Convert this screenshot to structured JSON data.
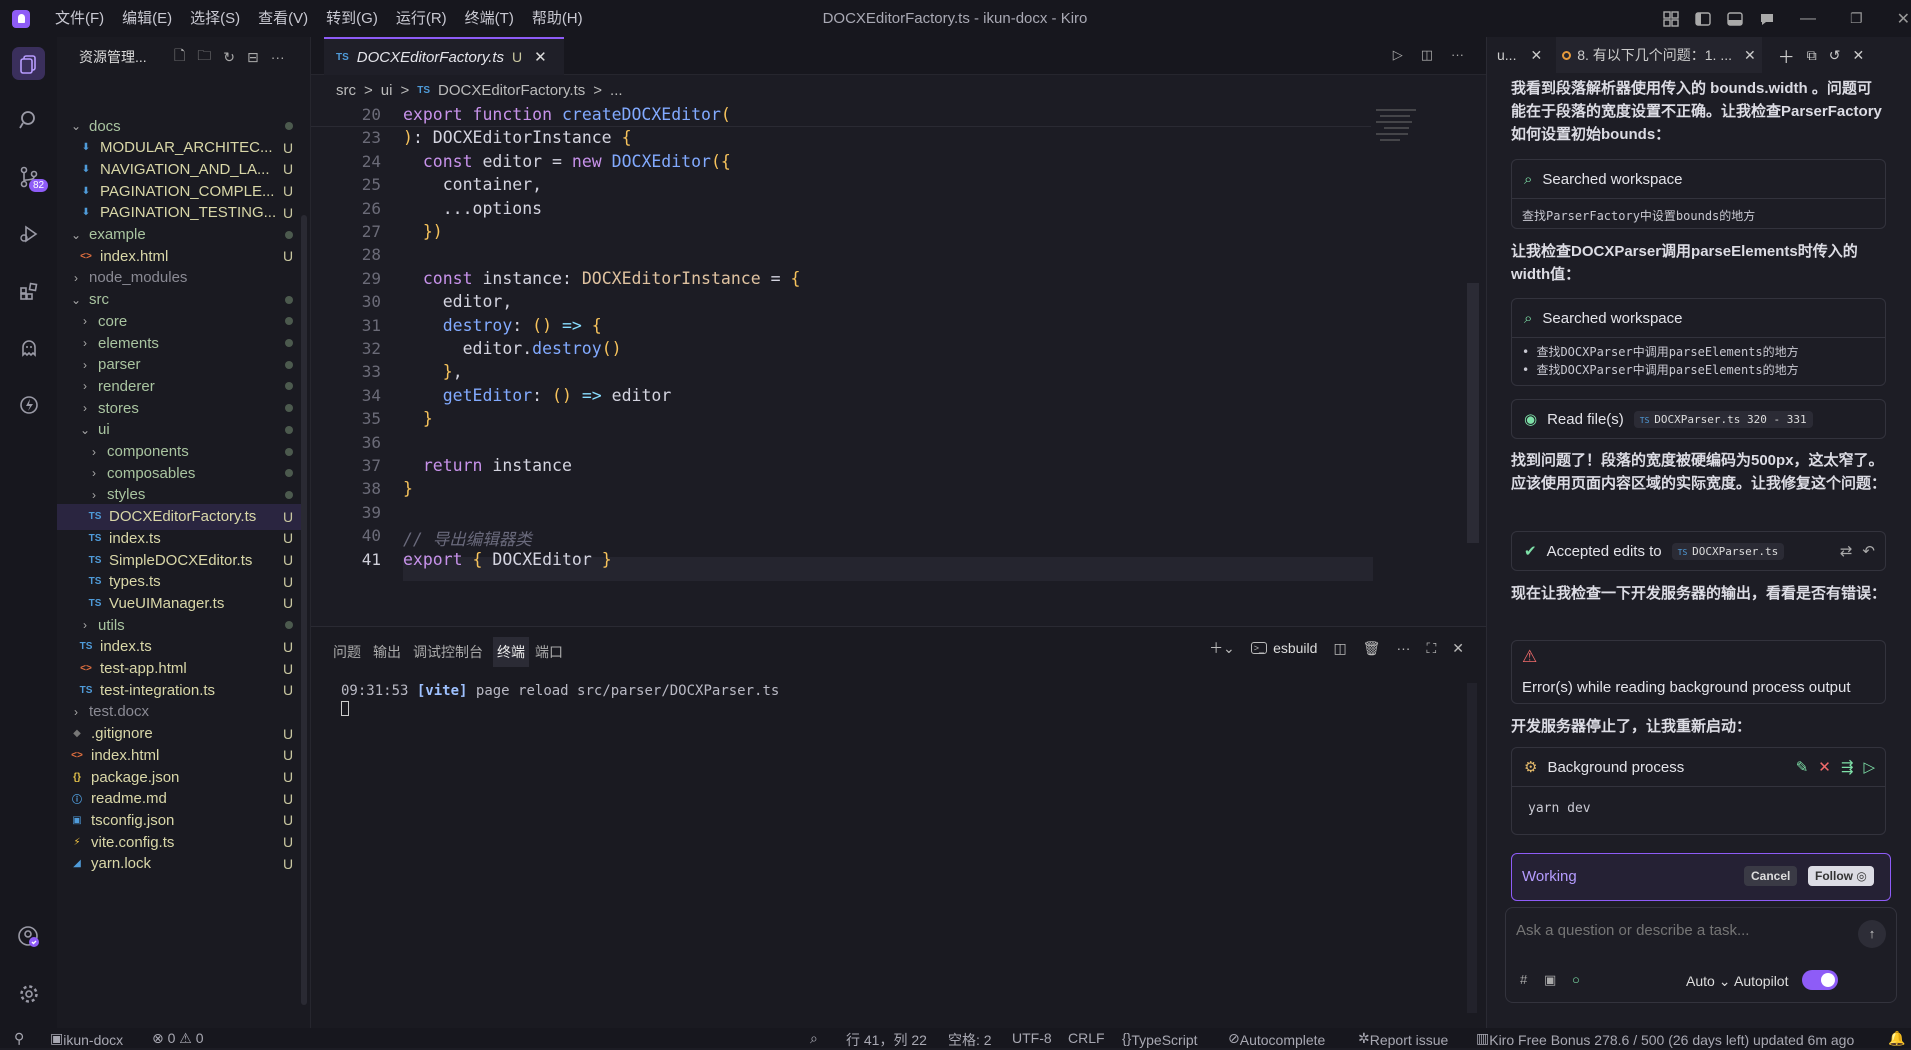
{
  "titlebar": {
    "menu": [
      "文件(F)",
      "编辑(E)",
      "选择(S)",
      "查看(V)",
      "转到(G)",
      "运行(R)",
      "终端(T)",
      "帮助(H)"
    ],
    "title": "DOCXEditorFactory.ts - ikun-docx - Kiro"
  },
  "activity": {
    "scm_badge": "82"
  },
  "explorer": {
    "header": "资源管理...",
    "tree": [
      {
        "label": "docs",
        "kind": "folder-open",
        "indent": 0,
        "status": "dot"
      },
      {
        "label": "MODULAR_ARCHITEC...",
        "kind": "md",
        "indent": 1,
        "status": "U"
      },
      {
        "label": "NAVIGATION_AND_LA...",
        "kind": "md",
        "indent": 1,
        "status": "U"
      },
      {
        "label": "PAGINATION_COMPLE...",
        "kind": "md",
        "indent": 1,
        "status": "U"
      },
      {
        "label": "PAGINATION_TESTING...",
        "kind": "md",
        "indent": 1,
        "status": "U"
      },
      {
        "label": "example",
        "kind": "folder-open",
        "indent": 0,
        "status": "dot"
      },
      {
        "label": "index.html",
        "kind": "html",
        "indent": 1,
        "status": "U"
      },
      {
        "label": "node_modules",
        "kind": "folder",
        "indent": 0,
        "status": "",
        "dim": true
      },
      {
        "label": "src",
        "kind": "folder-open",
        "indent": 0,
        "status": "dot"
      },
      {
        "label": "core",
        "kind": "folder",
        "indent": 1,
        "status": "dot"
      },
      {
        "label": "elements",
        "kind": "folder",
        "indent": 1,
        "status": "dot"
      },
      {
        "label": "parser",
        "kind": "folder",
        "indent": 1,
        "status": "dot"
      },
      {
        "label": "renderer",
        "kind": "folder",
        "indent": 1,
        "status": "dot"
      },
      {
        "label": "stores",
        "kind": "folder",
        "indent": 1,
        "status": "dot"
      },
      {
        "label": "ui",
        "kind": "folder-open",
        "indent": 1,
        "status": "dot"
      },
      {
        "label": "components",
        "kind": "folder",
        "indent": 2,
        "status": "dot"
      },
      {
        "label": "composables",
        "kind": "folder",
        "indent": 2,
        "status": "dot"
      },
      {
        "label": "styles",
        "kind": "folder",
        "indent": 2,
        "status": "dot"
      },
      {
        "label": "DOCXEditorFactory.ts",
        "kind": "ts",
        "indent": 2,
        "status": "U",
        "selected": true
      },
      {
        "label": "index.ts",
        "kind": "ts",
        "indent": 2,
        "status": "U"
      },
      {
        "label": "SimpleDOCXEditor.ts",
        "kind": "ts",
        "indent": 2,
        "status": "U"
      },
      {
        "label": "types.ts",
        "kind": "ts",
        "indent": 2,
        "status": "U"
      },
      {
        "label": "VueUIManager.ts",
        "kind": "ts",
        "indent": 2,
        "status": "U"
      },
      {
        "label": "utils",
        "kind": "folder",
        "indent": 1,
        "status": "dot"
      },
      {
        "label": "index.ts",
        "kind": "ts",
        "indent": 1,
        "status": "U"
      },
      {
        "label": "test-app.html",
        "kind": "html",
        "indent": 1,
        "status": "U"
      },
      {
        "label": "test-integration.ts",
        "kind": "ts",
        "indent": 1,
        "status": "U"
      },
      {
        "label": "test.docx",
        "kind": "folder",
        "indent": 0,
        "status": "",
        "dim": true
      },
      {
        "label": ".gitignore",
        "kind": "git",
        "indent": 0,
        "status": "U"
      },
      {
        "label": "index.html",
        "kind": "html",
        "indent": 0,
        "status": "U"
      },
      {
        "label": "package.json",
        "kind": "json",
        "indent": 0,
        "status": "U"
      },
      {
        "label": "readme.md",
        "kind": "info",
        "indent": 0,
        "status": "U"
      },
      {
        "label": "tsconfig.json",
        "kind": "tsconfig",
        "indent": 0,
        "status": "U"
      },
      {
        "label": "vite.config.ts",
        "kind": "vite",
        "indent": 0,
        "status": "U"
      },
      {
        "label": "yarn.lock",
        "kind": "yarn",
        "indent": 0,
        "status": "U"
      }
    ]
  },
  "editor": {
    "tab": {
      "icon": "TS",
      "label": "DOCXEditorFactory.ts",
      "status": "U"
    },
    "breadcrumb": [
      "src",
      ">",
      "ui",
      ">",
      "TS",
      "DOCXEditorFactory.ts",
      ">",
      "..."
    ],
    "lines": [
      {
        "n": "20",
        "tokens": [
          [
            "kw",
            "export "
          ],
          [
            "kw",
            "function "
          ],
          [
            "fn",
            "createDOCXEditor"
          ],
          [
            "br",
            "("
          ]
        ]
      },
      {
        "n": "23",
        "tokens": [
          [
            "br",
            ")"
          ],
          [
            "pl",
            ": DOCXEditorInstance "
          ],
          [
            "br",
            "{"
          ]
        ]
      },
      {
        "n": "24",
        "tokens": [
          [
            "pl",
            "  "
          ],
          [
            "kw",
            "const "
          ],
          [
            "pl",
            "editor = "
          ],
          [
            "kw",
            "new "
          ],
          [
            "fn",
            "DOCXEditor"
          ],
          [
            "br",
            "({"
          ]
        ]
      },
      {
        "n": "25",
        "tokens": [
          [
            "pl",
            "    container,"
          ]
        ]
      },
      {
        "n": "26",
        "tokens": [
          [
            "pl",
            "    ..."
          ],
          [
            "pl",
            "options"
          ]
        ]
      },
      {
        "n": "27",
        "tokens": [
          [
            "pl",
            "  "
          ],
          [
            "br",
            "})"
          ]
        ]
      },
      {
        "n": "28",
        "tokens": []
      },
      {
        "n": "29",
        "tokens": [
          [
            "pl",
            "  "
          ],
          [
            "kw",
            "const "
          ],
          [
            "pl",
            "instance: "
          ],
          [
            "ty",
            "DOCXEditorInstance"
          ],
          [
            "pl",
            " = "
          ],
          [
            "br",
            "{"
          ]
        ]
      },
      {
        "n": "30",
        "tokens": [
          [
            "pl",
            "    editor,"
          ]
        ]
      },
      {
        "n": "31",
        "tokens": [
          [
            "pl",
            "    "
          ],
          [
            "fn",
            "destroy"
          ],
          [
            "pl",
            ": "
          ],
          [
            "br",
            "() "
          ],
          [
            "op",
            "=> "
          ],
          [
            "br",
            "{"
          ]
        ]
      },
      {
        "n": "32",
        "tokens": [
          [
            "pl",
            "      editor."
          ],
          [
            "fn",
            "destroy"
          ],
          [
            "br",
            "()"
          ]
        ]
      },
      {
        "n": "33",
        "tokens": [
          [
            "pl",
            "    "
          ],
          [
            "br",
            "}"
          ],
          [
            "pl",
            ","
          ]
        ]
      },
      {
        "n": "34",
        "tokens": [
          [
            "pl",
            "    "
          ],
          [
            "fn",
            "getEditor"
          ],
          [
            "pl",
            ": "
          ],
          [
            "br",
            "() "
          ],
          [
            "op",
            "=> "
          ],
          [
            "pl",
            "editor"
          ]
        ]
      },
      {
        "n": "35",
        "tokens": [
          [
            "pl",
            "  "
          ],
          [
            "br",
            "}"
          ]
        ]
      },
      {
        "n": "36",
        "tokens": []
      },
      {
        "n": "37",
        "tokens": [
          [
            "pl",
            "  "
          ],
          [
            "kw",
            "return "
          ],
          [
            "pl",
            "instance"
          ]
        ]
      },
      {
        "n": "38",
        "tokens": [
          [
            "br",
            "}"
          ]
        ]
      },
      {
        "n": "39",
        "tokens": []
      },
      {
        "n": "40",
        "tokens": [
          [
            "cm",
            "// 导出编辑器类"
          ]
        ]
      },
      {
        "n": "41",
        "tokens": [
          [
            "kw",
            "export "
          ],
          [
            "br",
            "{ "
          ],
          [
            "pl",
            "DOCXEditor "
          ],
          [
            "br",
            "}"
          ]
        ]
      }
    ]
  },
  "panel": {
    "tabs": [
      "问题",
      "输出",
      "调试控制台",
      "终端",
      "端口"
    ],
    "active_tab": "终端",
    "terminal_name": "esbuild",
    "output": {
      "time": "09:31:53",
      "tag": "[vite]",
      "text": "page reload src/parser/DOCXParser.ts"
    }
  },
  "chat": {
    "tab_left": "u...",
    "tab_active": "8. 有以下几个问题：1. ...",
    "messages": [
      "我看到段落解析器使用传入的 bounds.width 。问题可能在于段落的宽度设置不正确。让我检查ParserFactory如何设置初始bounds：",
      "让我检查DOCXParser调用parseElements时传入的width值：",
      "找到问题了！段落的宽度被硬编码为500px，这太窄了。应该使用页面内容区域的实际宽度。让我修复这个问题：",
      "现在让我检查一下开发服务器的输出，看看是否有错误：",
      "开发服务器停止了，让我重新启动："
    ],
    "search1": {
      "title": "Searched workspace",
      "detail": "查找ParserFactory中设置bounds的地方"
    },
    "search2": {
      "title": "Searched workspace",
      "items": [
        "查找DOCXParser中调用parseElements的地方",
        "查找DOCXParser中调用parseElements的地方"
      ]
    },
    "readfile": {
      "title": "Read file(s)",
      "file": "DOCXParser.ts 320 - 331"
    },
    "accepted": {
      "title": "Accepted edits to",
      "file": "DOCXParser.ts"
    },
    "error": {
      "title": "Error(s) while reading background process output"
    },
    "bgproc": {
      "title": "Background process",
      "command": "yarn dev"
    },
    "working": {
      "label": "Working",
      "cancel": "Cancel",
      "follow": "Follow"
    },
    "input_placeholder": "Ask a question or describe a task...",
    "mode": "Auto",
    "autopilot": "Autopilot"
  },
  "status": {
    "branch": "ikun-docx",
    "problems": "⊗ 0 ⚠ 0",
    "position": "行 41，列 22",
    "spaces": "空格: 2",
    "encoding": "UTF-8",
    "eol": "CRLF",
    "language": "TypeScript",
    "autocomplete": "Autocomplete",
    "report": "Report issue",
    "plan": "Kiro Free Bonus 278.6 / 500 (26 days left) updated 6m ago"
  },
  "colors": {
    "accent": "#8e5cf7",
    "ts_blue": "#4f9bd9",
    "untracked": "#c9c7a0"
  }
}
